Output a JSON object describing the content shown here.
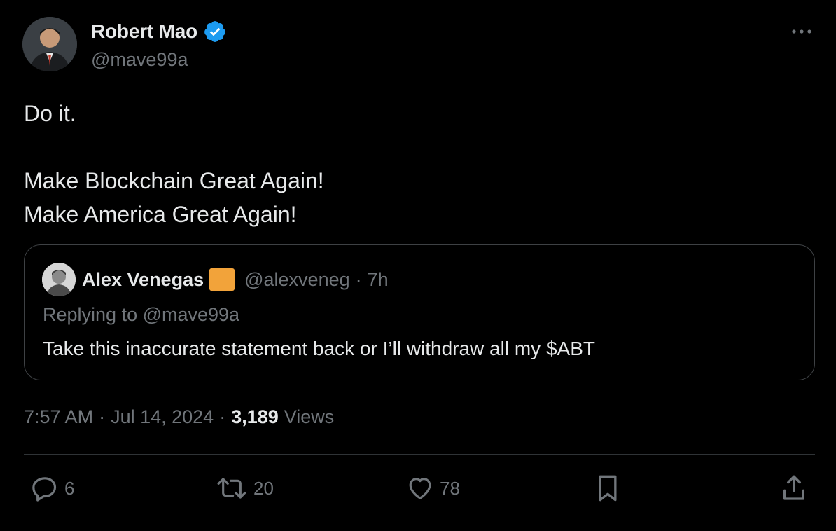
{
  "author": {
    "display_name": "Robert Mao",
    "handle": "@mave99a",
    "verified_icon": "verified-badge-icon"
  },
  "tweet": {
    "lines": [
      "Do it.",
      "",
      "Make Blockchain Great Again!",
      "Make America Great Again!"
    ]
  },
  "quoted": {
    "display_name": "Alex Venegas",
    "badge_color": "#f2a33a",
    "handle": "@alexveneg",
    "separator": "·",
    "time": "7h",
    "replying_to": "Replying to @mave99a",
    "text": "Take this inaccurate statement back or I’ll withdraw all my $ABT"
  },
  "meta": {
    "time": "7:57 AM",
    "sep1": "·",
    "date": "Jul 14, 2024",
    "sep2": "·",
    "views_count": "3,189",
    "views_label": "Views"
  },
  "actions": {
    "replies": "6",
    "reposts": "20",
    "likes": "78"
  },
  "colors": {
    "background": "#000000",
    "text_primary": "#e7e9ea",
    "text_secondary": "#71767b",
    "verified": "#1d9bf0",
    "border": "#3e4144"
  }
}
